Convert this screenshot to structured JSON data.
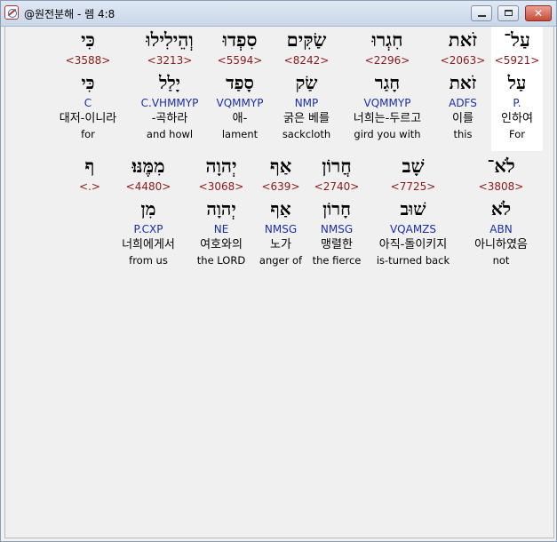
{
  "window": {
    "title": "@원전분해 - 렘 4:8",
    "controls": {
      "minimize": "minimize",
      "maximize": "maximize",
      "close": "✕"
    }
  },
  "rows": [
    {
      "cells": [
        {
          "heb": "כִּי",
          "strong": "<3588>",
          "lemma": "כִּי",
          "morph": "C",
          "kor": "대저-이니라",
          "eng": "for"
        },
        {
          "heb": "וְהֵילִילוּ",
          "strong": "<3213>",
          "lemma": "יָלַל",
          "morph": "C.VHMMYP",
          "kor": "-곡하라",
          "eng": "and howl"
        },
        {
          "heb": "סִפְדוּ",
          "strong": "<5594>",
          "lemma": "סָפַד",
          "morph": "VQMMYP",
          "kor": "애-",
          "eng": "lament"
        },
        {
          "heb": "שַׂקִּים",
          "strong": "<8242>",
          "lemma": "שַׂק",
          "morph": "NMP",
          "kor": "굵은 베를",
          "eng": "sackcloth"
        },
        {
          "heb": "חִגְרוּ",
          "strong": "<2296>",
          "lemma": "חָגַר",
          "morph": "VQMMYP",
          "kor": "너희는-두르고",
          "eng": "gird you with"
        },
        {
          "heb": "זֹאת",
          "strong": "<2063>",
          "lemma": "זֹאת",
          "morph": "ADFS",
          "kor": "이를",
          "eng": "this"
        },
        {
          "heb": "עַל־",
          "strong": "<5921>",
          "lemma": "עַל",
          "morph": "P.",
          "kor": "인하여",
          "eng": "For"
        }
      ]
    },
    {
      "cells": [
        {
          "heb": "ף",
          "strong": "<.>",
          "lemma": "",
          "morph": "",
          "kor": "",
          "eng": ""
        },
        {
          "heb": "מִמֶּנּוּ׃",
          "strong": "<4480>",
          "lemma": "מִן",
          "morph": "P.CXP",
          "kor": "너희에게서",
          "eng": "from us"
        },
        {
          "heb": "יְהוָה",
          "strong": "<3068>",
          "lemma": "יְהוָה",
          "morph": "NE",
          "kor": "여호와의",
          "eng": "the LORD"
        },
        {
          "heb": "אַף",
          "strong": "<639>",
          "lemma": "אַף",
          "morph": "NMSG",
          "kor": "노가",
          "eng": "anger of"
        },
        {
          "heb": "חֲרוֹן",
          "strong": "<2740>",
          "lemma": "חָרוֹן",
          "morph": "NMSG",
          "kor": "맹렬한",
          "eng": "the fierce"
        },
        {
          "heb": "שָׁב",
          "strong": "<7725>",
          "lemma": "שׁוּב",
          "morph": "VQAMZS",
          "kor": "아직-돌이키지",
          "eng": "is-turned back"
        },
        {
          "heb": "לֹא־",
          "strong": "<3808>",
          "lemma": "לֹא",
          "morph": "ABN",
          "kor": "아니하였음",
          "eng": "not"
        }
      ]
    }
  ]
}
